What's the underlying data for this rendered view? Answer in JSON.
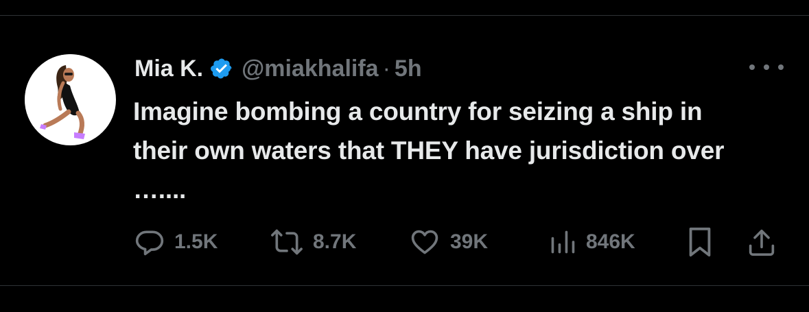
{
  "tweet": {
    "author_name": "Mia K.",
    "handle": "@miakhalifa",
    "separator": "·",
    "time": "5h",
    "verified_icon": "verified-badge-icon",
    "text": "Imagine bombing a country for seizing a ship in their own waters that THEY have jurisdiction over …....",
    "more_icon": "more-options-icon"
  },
  "actions": {
    "replies": "1.5K",
    "reposts": "8.7K",
    "likes": "39K",
    "views": "846K",
    "bookmark_icon": "bookmark-icon",
    "share_icon": "share-icon"
  },
  "colors": {
    "background": "#000000",
    "primary_text": "#e7e9ea",
    "secondary_text": "#71767b",
    "verified_blue": "#1d9bf0",
    "divider": "#2f3336"
  }
}
